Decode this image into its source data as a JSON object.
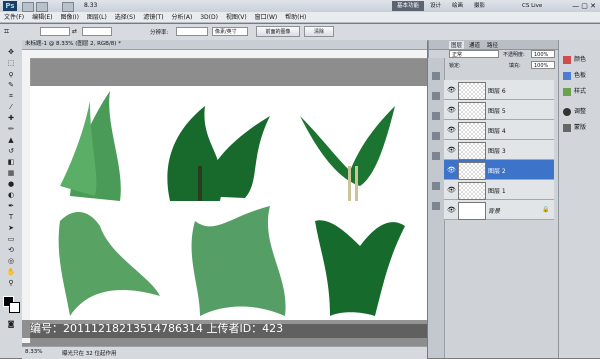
{
  "titlebar": {
    "logo": "Ps",
    "right_btns": [
      "基本功能",
      "设计",
      "绘画",
      "摄影"
    ],
    "cslive": "CS Live"
  },
  "menus": [
    "文件(F)",
    "编辑(E)",
    "图像(I)",
    "图层(L)",
    "选择(S)",
    "滤镜(T)",
    "分析(A)",
    "3D(D)",
    "视图(V)",
    "窗口(W)",
    "帮助(H)"
  ],
  "options": {
    "zoom": "8.33",
    "tolerance_label": "分辨率:",
    "unit": "像素/英寸",
    "btn1": "前面的图像",
    "btn2": "清除"
  },
  "doc": {
    "tab": "未标题-1 @ 8.33% (图层 2, RGB/8) *",
    "zoom": "8.33%",
    "status": "曝光只在 32 位起作用"
  },
  "watermark": "编号：20111218213514786314 上传者ID：423",
  "layers_panel": {
    "tabs": [
      "图层",
      "通道",
      "路径"
    ],
    "blend": "正常",
    "opacity_label": "不透明度:",
    "opacity": "100%",
    "lock_label": "锁定:",
    "fill_label": "填充:",
    "fill": "100%",
    "rows": [
      {
        "name": "图层 6",
        "selected": false
      },
      {
        "name": "图层 5",
        "selected": false
      },
      {
        "name": "图层 4",
        "selected": false
      },
      {
        "name": "图层 3",
        "selected": false
      },
      {
        "name": "图层 2",
        "selected": true
      },
      {
        "name": "图层 1",
        "selected": false
      },
      {
        "name": "背景",
        "selected": false
      }
    ]
  },
  "right_panel": {
    "items": [
      "颜色",
      "色板",
      "样式",
      "调整",
      "蒙版"
    ]
  },
  "colors": {
    "accent": "#3d73c9",
    "bamboo": "#1e6b2f"
  }
}
